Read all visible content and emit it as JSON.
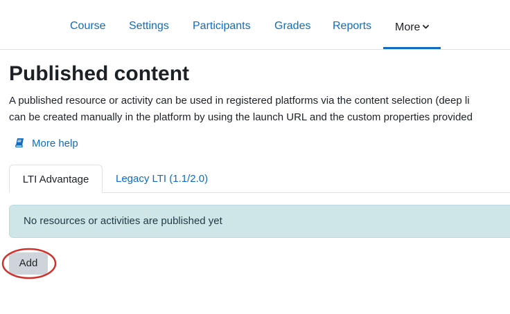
{
  "nav": {
    "items": [
      {
        "label": "Course"
      },
      {
        "label": "Settings"
      },
      {
        "label": "Participants"
      },
      {
        "label": "Grades"
      },
      {
        "label": "Reports"
      }
    ],
    "more_label": "More"
  },
  "page": {
    "title": "Published content",
    "intro_line1": "A published resource or activity can be used in registered platforms via the content selection (deep li",
    "intro_line2": "can be created manually in the platform by using the launch URL and the custom properties provided",
    "help_label": "More help"
  },
  "tabs": [
    {
      "label": "LTI Advantage",
      "active": true
    },
    {
      "label": "Legacy LTI (1.1/2.0)",
      "active": false
    }
  ],
  "alert": {
    "text": "No resources or activities are published yet"
  },
  "actions": {
    "add_label": "Add"
  },
  "colors": {
    "link": "#0f6cbf",
    "alert_bg": "#cfe6e9",
    "button_bg": "#ced4da",
    "highlight": "#d0312d"
  },
  "icons": {
    "help": "book-icon",
    "more": "chevron-down-icon"
  }
}
